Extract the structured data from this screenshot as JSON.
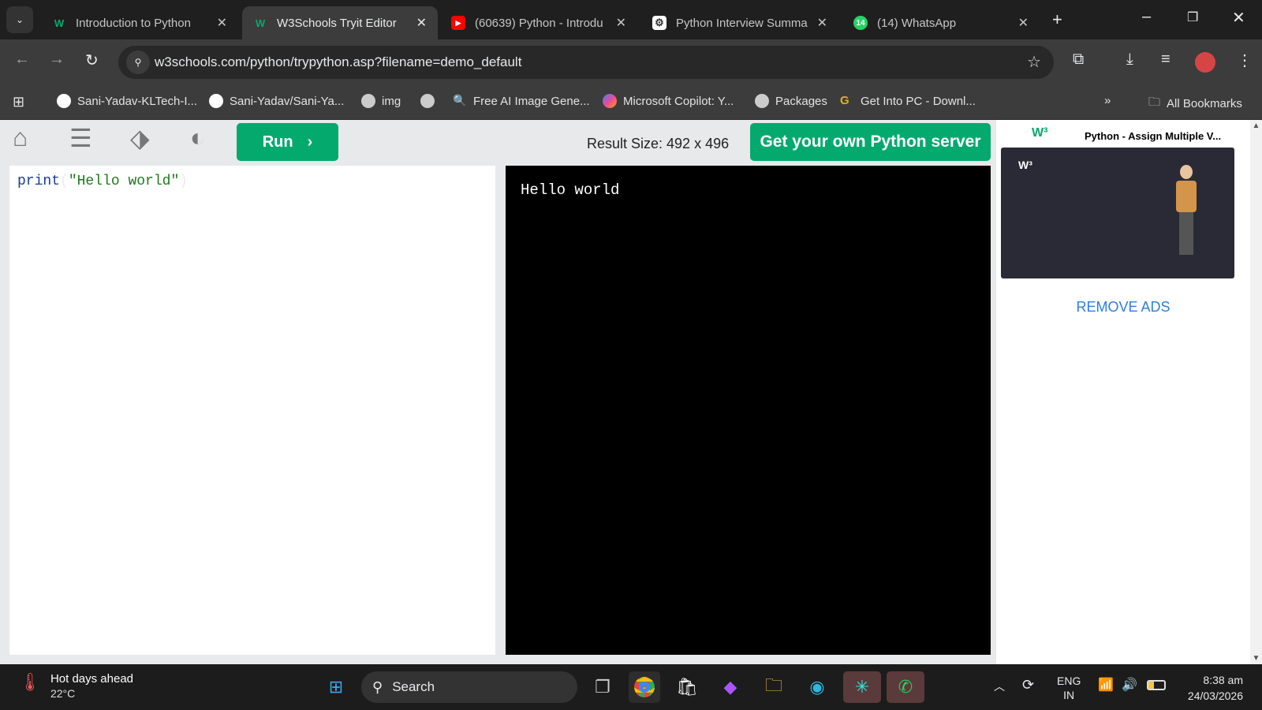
{
  "browser": {
    "tabs": [
      {
        "title": "Introduction to Python",
        "favicon": "w3schools-icon"
      },
      {
        "title": "W3Schools Tryit Editor",
        "favicon": "w3schools-icon",
        "active": true
      },
      {
        "title": "(60639) Python - Introdu",
        "favicon": "youtube-icon"
      },
      {
        "title": "Python Interview Summa",
        "favicon": "chatgpt-icon"
      },
      {
        "title": "(14) WhatsApp",
        "favicon": "whatsapp-icon",
        "badge": "14"
      }
    ],
    "url": "w3schools.com/python/trypython.asp?filename=demo_default",
    "bookmarks": [
      "Sani-Yadav-KLTech-I...",
      "Sani-Yadav/Sani-Ya...",
      "img",
      "",
      "Free AI Image Gene...",
      "Microsoft Copilot: Y...",
      "Packages",
      "Get Into PC - Downl..."
    ],
    "all_bookmarks": "All Bookmarks"
  },
  "tryit": {
    "run_label": "Run",
    "result_size": "Result Size: 492 x 496",
    "get_server": "Get your own Python server",
    "code": {
      "fn": "print",
      "open": "(",
      "str": "\"Hello world\"",
      "close": ")"
    },
    "output": "Hello world"
  },
  "ad": {
    "title": "Python - Assign Multiple V...",
    "logo": "w3schools",
    "remove_ads": "REMOVE ADS"
  },
  "taskbar": {
    "weather_title": "Hot days ahead",
    "weather_temp": "22°C",
    "search": "Search",
    "lang1": "ENG",
    "lang2": "IN",
    "time": "8:38 am",
    "date": "24/03/2026"
  },
  "colors": {
    "accent": "#04aa6d",
    "link": "#2f7ee0"
  }
}
